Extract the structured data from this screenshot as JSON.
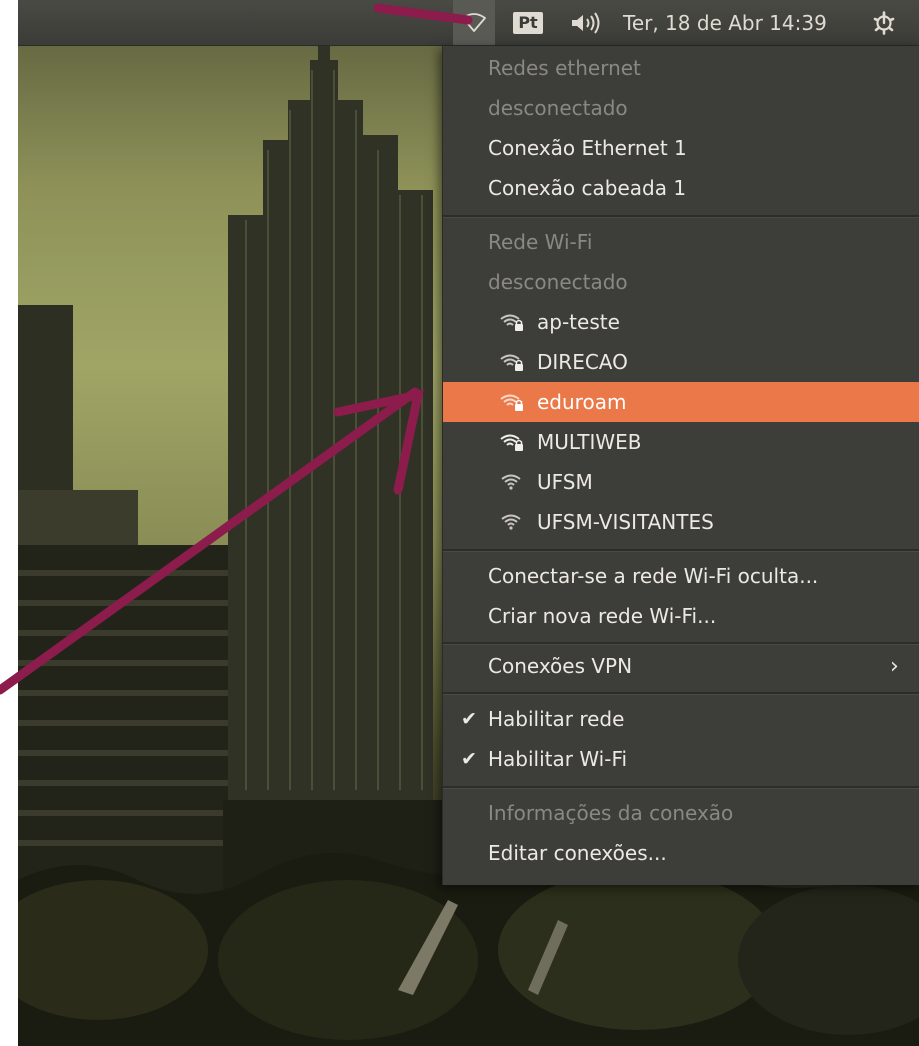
{
  "panel": {
    "language": "Pt",
    "clock": "Ter, 18 de Abr 14:39",
    "icons": {
      "wifi": "wifi-indicator-icon",
      "sound": "speaker-volume-icon",
      "session": "gear-power-icon"
    }
  },
  "menu": {
    "ethernet_header": "Redes ethernet",
    "ethernet_status": "desconectado",
    "ethernet_items": [
      "Conexão Ethernet 1",
      "Conexão cabeada 1"
    ],
    "wifi_header": "Rede Wi-Fi",
    "wifi_status": "desconectado",
    "networks": [
      {
        "name": "ap-teste",
        "secured": true,
        "highlighted": false
      },
      {
        "name": "DIRECAO",
        "secured": true,
        "highlighted": false
      },
      {
        "name": "eduroam",
        "secured": true,
        "highlighted": true
      },
      {
        "name": "MULTIWEB",
        "secured": true,
        "highlighted": false
      },
      {
        "name": "UFSM",
        "secured": false,
        "highlighted": false
      },
      {
        "name": "UFSM-VISITANTES",
        "secured": false,
        "highlighted": false
      }
    ],
    "hidden_network": "Conectar-se a rede Wi-Fi oculta...",
    "create_network": "Criar nova rede Wi-Fi...",
    "vpn": "Conexões VPN",
    "enable_network": "Habilitar rede",
    "enable_wifi": "Habilitar Wi-Fi",
    "connection_info": "Informações da conexão",
    "edit_connections": "Editar conexões..."
  },
  "colors": {
    "menu_bg": "#3d3d3a",
    "highlight": "#ea7848",
    "annotation_arrow": "#8c1c4b",
    "disabled_text": "#8a8882"
  }
}
